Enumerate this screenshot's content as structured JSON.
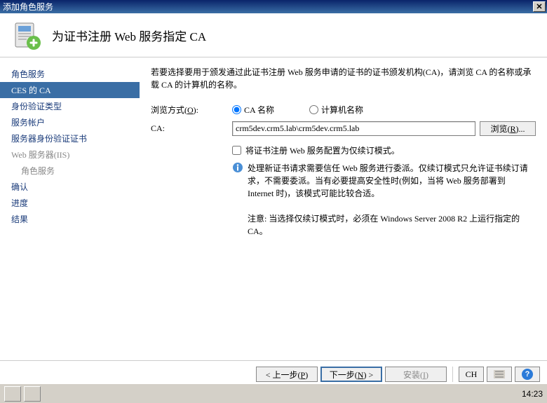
{
  "window": {
    "title": "添加角色服务"
  },
  "header": {
    "title": "为证书注册 Web 服务指定 CA"
  },
  "sidebar": {
    "items": [
      {
        "label": "角色服务"
      },
      {
        "label": "CES 的 CA"
      },
      {
        "label": "身份验证类型"
      },
      {
        "label": "服务帐户"
      },
      {
        "label": "服务器身份验证证书"
      },
      {
        "label": "Web 服务器(IIS)"
      },
      {
        "label": "角色服务"
      },
      {
        "label": "确认"
      },
      {
        "label": "进度"
      },
      {
        "label": "结果"
      }
    ]
  },
  "content": {
    "intro": "若要选择要用于颁发通过此证书注册 Web 服务申请的证书的证书颁发机构(CA)，请浏览 CA 的名称或承载 CA 的计算机的名称。",
    "browse_label": "浏览方式(O):",
    "radio_ca_name": "CA 名称",
    "radio_computer_name": "计算机名称",
    "ca_label": "CA:",
    "ca_value": "crm5dev.crm5.lab\\crm5dev.crm5.lab",
    "browse_btn": "浏览(R)...",
    "checkbox_label": "将证书注册 Web 服务配置为仅续订模式。",
    "info_text": "处理新证书请求需要信任 Web 服务进行委派。仅续订模式只允许证书续订请求，不需要委派。当有必要提高安全性时(例如，当将 Web 服务部署到 Internet 时)，该模式可能比较合适。",
    "note_text": "注意: 当选择仅续订模式时，必须在 Windows Server 2008 R2 上运行指定的 CA。"
  },
  "footer": {
    "prev": "< 上一步(P)",
    "next": "下一步(N) >",
    "install": "安装(I)",
    "cancel": "CH"
  },
  "taskbar": {
    "time": "14:23"
  }
}
